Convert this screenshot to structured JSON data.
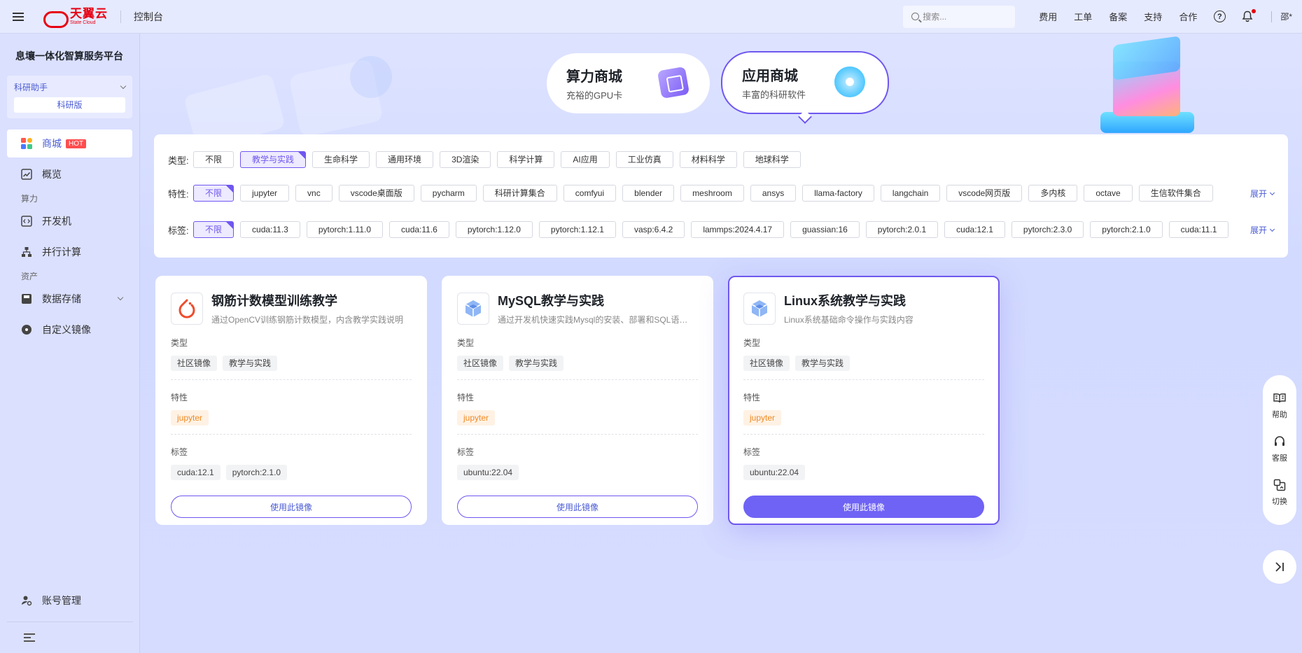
{
  "header": {
    "logo_main": "天翼云",
    "logo_sub": "State Cloud",
    "console": "控制台",
    "search_placeholder": "搜索...",
    "links": [
      "费用",
      "工单",
      "备案",
      "支持",
      "合作"
    ],
    "user": "邵*"
  },
  "sidebar": {
    "platform_title": "息壤一体化智算服务平台",
    "assistant": "科研助手",
    "edition": "科研版",
    "items": [
      {
        "label": "商城",
        "badge": "HOT"
      },
      {
        "label": "概览"
      }
    ],
    "group_compute": "算力",
    "compute_items": [
      {
        "label": "开发机"
      },
      {
        "label": "并行计算"
      }
    ],
    "group_assets": "资产",
    "asset_items": [
      {
        "label": "数据存储"
      },
      {
        "label": "自定义镜像"
      }
    ],
    "account": "账号管理"
  },
  "banner": {
    "stores": [
      {
        "title": "算力商城",
        "subtitle": "充裕的GPU卡"
      },
      {
        "title": "应用商城",
        "subtitle": "丰富的科研软件"
      }
    ]
  },
  "filters": {
    "type_label": "类型:",
    "type_tags": [
      "不限",
      "教学与实践",
      "生命科学",
      "通用环境",
      "3D渲染",
      "科学计算",
      "AI应用",
      "工业仿真",
      "材料科学",
      "地球科学"
    ],
    "feature_label": "特性:",
    "feature_tags": [
      "不限",
      "jupyter",
      "vnc",
      "vscode桌面版",
      "pycharm",
      "科研计算集合",
      "comfyui",
      "blender",
      "meshroom",
      "ansys",
      "llama-factory",
      "langchain",
      "vscode网页版",
      "多内核",
      "octave",
      "生信软件集合"
    ],
    "tag_label": "标签:",
    "tag_tags": [
      "不限",
      "cuda:11.3",
      "pytorch:1.11.0",
      "cuda:11.6",
      "pytorch:1.12.0",
      "pytorch:1.12.1",
      "vasp:6.4.2",
      "lammps:2024.4.17",
      "guassian:16",
      "pytorch:2.0.1",
      "cuda:12.1",
      "pytorch:2.3.0",
      "pytorch:2.1.0",
      "cuda:11.1"
    ],
    "expand": "展开"
  },
  "cards": [
    {
      "title": "钢筋计数模型训练教学",
      "desc": "通过OpenCV训练钢筋计数模型，内含教学实践说明",
      "type_label": "类型",
      "types": [
        "社区镜像",
        "教学与实践"
      ],
      "feature_label": "特性",
      "features": [
        "jupyter"
      ],
      "tag_label": "标签",
      "tags": [
        "cuda:12.1",
        "pytorch:2.1.0"
      ],
      "button": "使用此镜像"
    },
    {
      "title": "MySQL教学与实践",
      "desc": "通过开发机快速实践Mysql的安装、部署和SQL语句操作",
      "type_label": "类型",
      "types": [
        "社区镜像",
        "教学与实践"
      ],
      "feature_label": "特性",
      "features": [
        "jupyter"
      ],
      "tag_label": "标签",
      "tags": [
        "ubuntu:22.04"
      ],
      "button": "使用此镜像"
    },
    {
      "title": "Linux系统教学与实践",
      "desc": "Linux系统基础命令操作与实践内容",
      "type_label": "类型",
      "types": [
        "社区镜像",
        "教学与实践"
      ],
      "feature_label": "特性",
      "features": [
        "jupyter"
      ],
      "tag_label": "标签",
      "tags": [
        "ubuntu:22.04"
      ],
      "button": "使用此镜像"
    }
  ],
  "float": {
    "items": [
      "帮助",
      "客服",
      "切换"
    ]
  },
  "colors": {
    "accent": "#6f57f0",
    "brand_red": "#e60012",
    "orange_tag": "#f08a24"
  }
}
